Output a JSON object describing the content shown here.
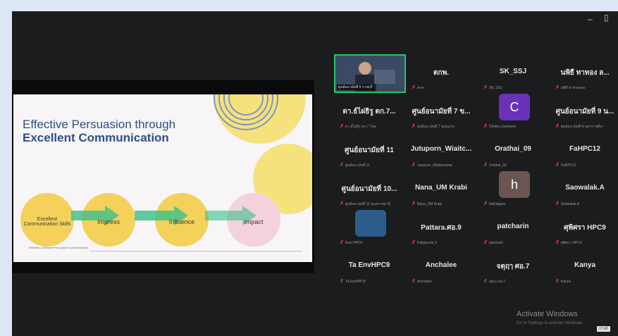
{
  "window": {
    "minimize_glyph": "–",
    "maximize_glyph": "▯"
  },
  "slide": {
    "title_line1": "Effective Persuasion through",
    "title_line2": "Excellent Communication",
    "steps": [
      "Excellent Communication Skills",
      "Impress",
      "Influence",
      "Impact"
    ],
    "footnote": "Effective & Efficient Persuasion Communication"
  },
  "gallery": {
    "participants": [
      {
        "name": "",
        "sub": "",
        "video": true
      },
      {
        "name": "ตกพ.",
        "sub": "ตกพ"
      },
      {
        "name": "SK_SSJ",
        "sub": "SK_SSJ"
      },
      {
        "name": "นพิธี ทาทอง ล...",
        "sub": "นพิธี ทาทองทอง"
      },
      {
        "name": "ดา.ธ์ไผ่ธิรู ตก.7...",
        "sub": "ดา.ธ์ไผ่ธิรู ตก.7 ไทย"
      },
      {
        "name": "ศูนย์อนามัยที่ 7 ข...",
        "sub": "ศูนย์อนามัยที่ 7 ขอนแก่น"
      },
      {
        "name": "",
        "sub": "Chotiru Sunkamn",
        "avatar": "C",
        "avatar_color": "#6a32b8"
      },
      {
        "name": "ศูนย์อนามัยที่ 9 น...",
        "sub": "ศูนย์อนามัยที่ 9 นครราชสีมา"
      },
      {
        "name": "ศูนย์อนามัยที่ 11",
        "sub": "ศูนย์อนามัยที่ 11"
      },
      {
        "name": "Jutuporn_Wiaitc...",
        "sub": "Jutuporn_Wiaitcsuwan"
      },
      {
        "name": "Orathai_09",
        "sub": "Orathai_09"
      },
      {
        "name": "FaHPC12",
        "sub": "FaHPC12"
      },
      {
        "name": "ศูนย์อนามัยที่ 10...",
        "sub": "ศูนย์อนามัยที่ 10 อุบลราชธานี"
      },
      {
        "name": "Nana_UM Krabi",
        "sub": "Nana_UM Krabi"
      },
      {
        "name": "",
        "sub": "hathaigarn",
        "avatar": "h",
        "avatar_color": "#6b5550"
      },
      {
        "name": "Saowalak.A",
        "sub": "Saowalak.A"
      },
      {
        "name": "",
        "sub": "Envi HPC5",
        "avatar": "",
        "avatar_color": "#2c5d8a"
      },
      {
        "name": "Pattara.ศอ.9",
        "sub": "Pattara.ศอ.9"
      },
      {
        "name": "patcharin",
        "sub": "patcharin"
      },
      {
        "name": "ศุพิศรา HPC9",
        "sub": "ศุพิศรา HPC9"
      },
      {
        "name": "Ta EnvHPC9",
        "sub": "Ta EnvHPC9"
      },
      {
        "name": "Anchalee",
        "sub": "Anchalee"
      },
      {
        "name": "จตุฤๅ ศอ.7",
        "sub": "จตุฤๅ ศอ.7"
      },
      {
        "name": "Kanya",
        "sub": "Kanya"
      }
    ]
  },
  "watermark": {
    "title": "Activate Windows",
    "sub": "Go to Settings to activate Windows."
  },
  "taskbar_time": "17:43"
}
